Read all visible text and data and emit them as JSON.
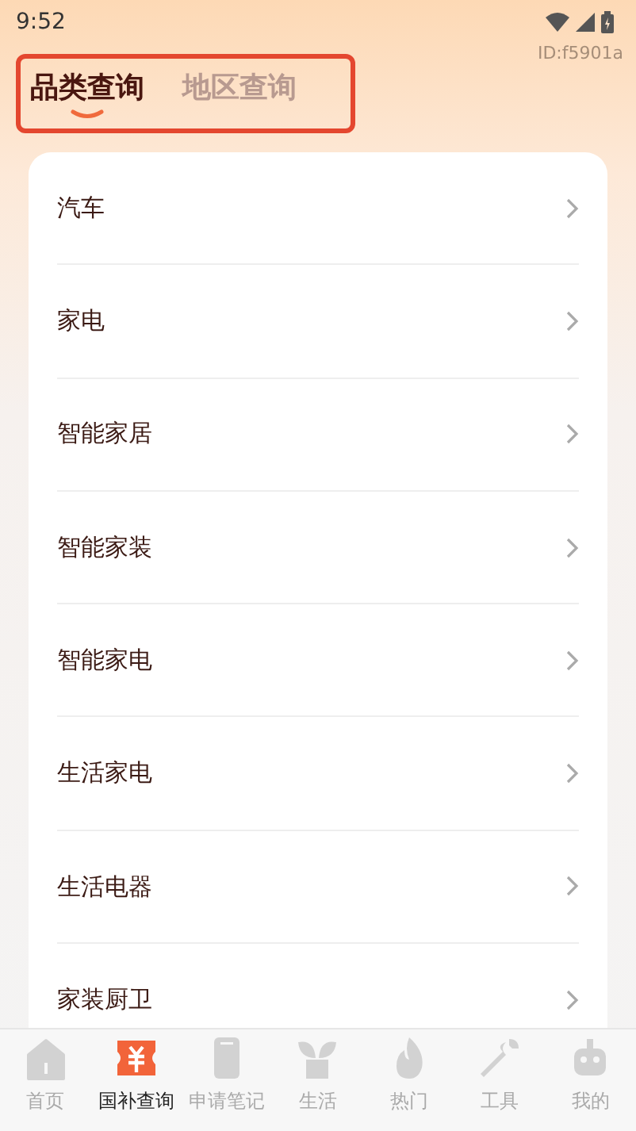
{
  "status_bar": {
    "time": "9:52"
  },
  "id_label": "ID:f5901a",
  "tabs": [
    {
      "label": "品类查询",
      "selected": true
    },
    {
      "label": "地区查询",
      "selected": false
    }
  ],
  "categories": [
    {
      "label": "汽车"
    },
    {
      "label": "家电"
    },
    {
      "label": "智能家居"
    },
    {
      "label": "智能家装"
    },
    {
      "label": "智能家电"
    },
    {
      "label": "生活家电"
    },
    {
      "label": "生活电器"
    },
    {
      "label": "家装厨卫"
    }
  ],
  "bottom_nav": [
    {
      "label": "首页",
      "selected": false
    },
    {
      "label": "国补查询",
      "selected": true
    },
    {
      "label": "申请笔记",
      "selected": false
    },
    {
      "label": "生活",
      "selected": false
    },
    {
      "label": "热门",
      "selected": false
    },
    {
      "label": "工具",
      "selected": false
    },
    {
      "label": "我的",
      "selected": false
    }
  ]
}
